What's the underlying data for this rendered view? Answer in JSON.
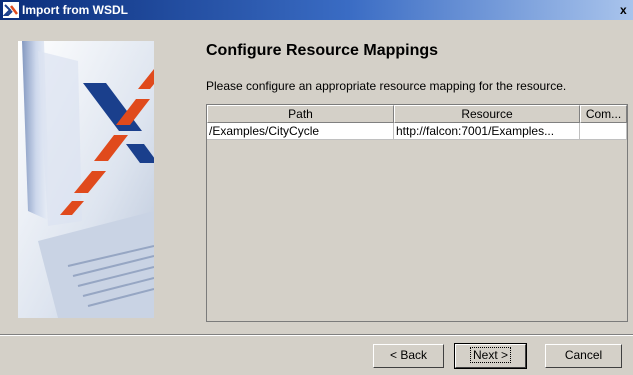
{
  "window": {
    "title": "Import from WSDL",
    "close_label": "x",
    "close_icon": "close-icon"
  },
  "page": {
    "heading": "Configure Resource Mappings",
    "description": "Please configure an appropriate resource mapping for the resource."
  },
  "table": {
    "columns": [
      "Path",
      "Resource",
      "Com..."
    ],
    "rows": [
      {
        "path": "/Examples/CityCycle",
        "resource": "http://falcon:7001/Examples...",
        "comment": ""
      }
    ]
  },
  "buttons": {
    "back": "< Back",
    "next": "Next >",
    "cancel": "Cancel"
  },
  "colors": {
    "accent": "#e04a1c",
    "logo_blue": "#1a3f8c",
    "dialog_bg": "#d4d0c8"
  }
}
